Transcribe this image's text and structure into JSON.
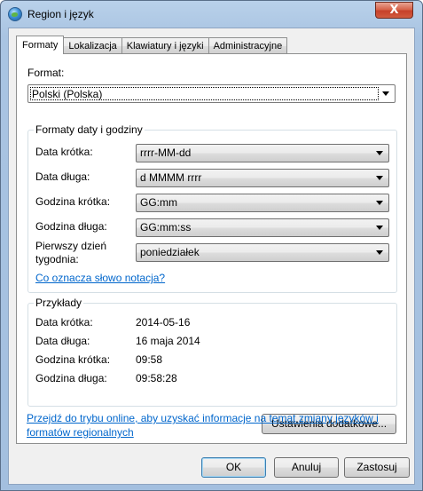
{
  "window": {
    "title": "Region i język",
    "close_label": "X"
  },
  "tabs": [
    {
      "label": "Formaty"
    },
    {
      "label": "Lokalizacja"
    },
    {
      "label": "Klawiatury i języki"
    },
    {
      "label": "Administracyjne"
    }
  ],
  "format": {
    "label": "Format:",
    "value": "Polski (Polska)"
  },
  "datetime_group": {
    "title": "Formaty daty i godziny",
    "rows": [
      {
        "label": "Data krótka:",
        "value": "rrrr-MM-dd"
      },
      {
        "label": "Data długa:",
        "value": "d MMMM rrrr"
      },
      {
        "label": "Godzina krótka:",
        "value": "GG:mm"
      },
      {
        "label": "Godzina długa:",
        "value": "GG:mm:ss"
      },
      {
        "label_line1": "Pierwszy dzień",
        "label_line2": "tygodnia:",
        "value": "poniedziałek"
      }
    ],
    "notation_link": "Co oznacza słowo notacja?"
  },
  "examples_group": {
    "title": "Przykłady",
    "rows": [
      {
        "label": "Data krótka:",
        "value": "2014-05-16"
      },
      {
        "label": "Data długa:",
        "value": "16 maja 2014"
      },
      {
        "label": "Godzina krótka:",
        "value": "09:58"
      },
      {
        "label": "Godzina długa:",
        "value": "09:58:28"
      }
    ]
  },
  "additional_settings_button": "Ustawienia dodatkowe...",
  "online_link_line1": "Przejdź do trybu online, aby uzyskać informacje na temat zmiany języków i",
  "online_link_line2": "formatów regionalnych",
  "footer": {
    "ok": "OK",
    "cancel": "Anuluj",
    "apply": "Zastosuj"
  }
}
